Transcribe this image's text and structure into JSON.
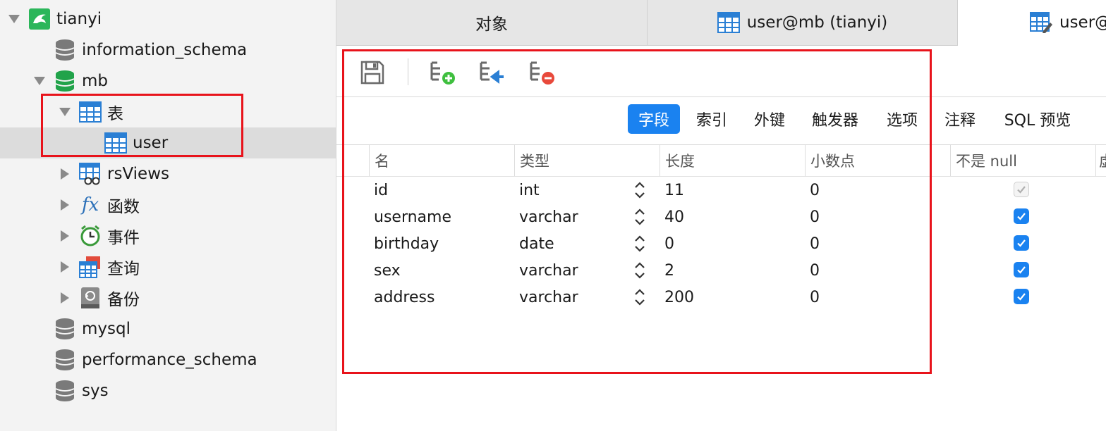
{
  "sidebar": {
    "connection": {
      "label": "tianyi",
      "icon": "dolphin-connection-icon"
    },
    "items": [
      {
        "label": "information_schema",
        "icon": "database-icon"
      },
      {
        "label": "mb",
        "icon": "database-open-icon"
      },
      {
        "label": "表",
        "icon": "table-group-icon"
      },
      {
        "label": "user",
        "icon": "table-icon"
      },
      {
        "label": "rsViews",
        "icon": "view-icon"
      },
      {
        "label": "函数",
        "icon": "function-icon"
      },
      {
        "label": "事件",
        "icon": "clock-icon"
      },
      {
        "label": "查询",
        "icon": "query-icon"
      },
      {
        "label": "备份",
        "icon": "backup-icon"
      },
      {
        "label": "mysql",
        "icon": "database-icon"
      },
      {
        "label": "performance_schema",
        "icon": "database-icon"
      },
      {
        "label": "sys",
        "icon": "database-icon"
      }
    ]
  },
  "tabs": [
    {
      "label": "对象"
    },
    {
      "label": "user@mb (tianyi)",
      "icon": "table-icon"
    },
    {
      "label": "user@",
      "icon": "table-edit-icon"
    }
  ],
  "toolbar": {
    "buttons": [
      {
        "name": "save",
        "icon": "save-icon"
      },
      {
        "name": "add-field",
        "icon": "add-field-icon"
      },
      {
        "name": "insert-field",
        "icon": "insert-field-icon"
      },
      {
        "name": "delete-field",
        "icon": "delete-field-icon"
      }
    ]
  },
  "subtabs": [
    "字段",
    "索引",
    "外键",
    "触发器",
    "选项",
    "注释",
    "SQL 预览"
  ],
  "grid": {
    "headers": [
      "名",
      "类型",
      "长度",
      "小数点",
      "不是 null",
      "虚"
    ],
    "rows": [
      {
        "name": "id",
        "type": "int",
        "length": "11",
        "decimals": "0",
        "not_null": true,
        "not_null_disabled": true
      },
      {
        "name": "username",
        "type": "varchar",
        "length": "40",
        "decimals": "0",
        "not_null": true,
        "not_null_disabled": false
      },
      {
        "name": "birthday",
        "type": "date",
        "length": "0",
        "decimals": "0",
        "not_null": true,
        "not_null_disabled": false
      },
      {
        "name": "sex",
        "type": "varchar",
        "length": "2",
        "decimals": "0",
        "not_null": true,
        "not_null_disabled": false
      },
      {
        "name": "address",
        "type": "varchar",
        "length": "200",
        "decimals": "0",
        "not_null": true,
        "not_null_disabled": false
      }
    ]
  },
  "colors": {
    "accent": "#1a82f0",
    "highlight": "#e8131b",
    "db_green": "#21a34a"
  }
}
